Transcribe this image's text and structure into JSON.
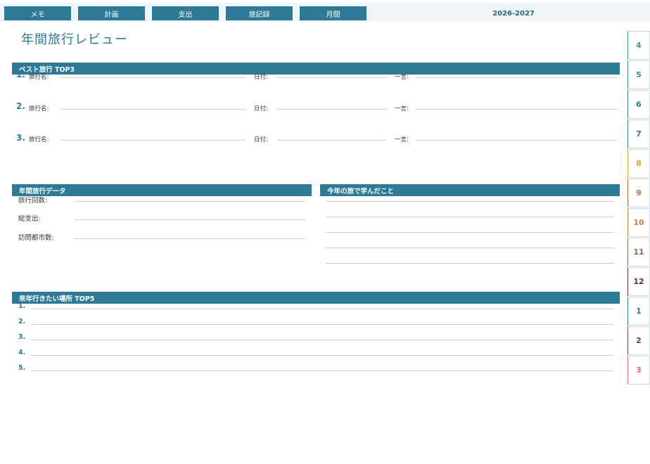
{
  "nav": {
    "buttons": [
      "メモ",
      "計画",
      "支出",
      "旅記録",
      "月間"
    ],
    "year": "2026-2027"
  },
  "page_title": "年間旅行レビュー",
  "best_trips": {
    "header": "ベスト旅行 TOP3",
    "items": [
      {
        "num": "1.",
        "name_label": "旅行名:",
        "date_label": "日付:",
        "comment_label": "一言:"
      },
      {
        "num": "2.",
        "name_label": "旅行名:",
        "date_label": "日付:",
        "comment_label": "一言:"
      },
      {
        "num": "3.",
        "name_label": "旅行名:",
        "date_label": "日付:",
        "comment_label": "一言:"
      }
    ]
  },
  "annual_data": {
    "header": "年間旅行データ",
    "fields": [
      "旅行回数:",
      "総支出:",
      "訪問都市数:"
    ]
  },
  "lessons": {
    "header": "今年の旅で学んだこと"
  },
  "next_year": {
    "header": "来年行きたい場所 TOP5",
    "items": [
      "1.",
      "2.",
      "3.",
      "4.",
      "5."
    ]
  },
  "month_tabs": [
    {
      "label": "4",
      "color": "#3aa67a"
    },
    {
      "label": "5",
      "color": "#2e9aa3"
    },
    {
      "label": "6",
      "color": "#2e7a96"
    },
    {
      "label": "7",
      "color": "#2e7a96"
    },
    {
      "label": "8",
      "color": "#e0a030"
    },
    {
      "label": "9",
      "color": "#d06a3a"
    },
    {
      "label": "10",
      "color": "#d07a3a"
    },
    {
      "label": "11",
      "color": "#8a6a5a"
    },
    {
      "label": "12",
      "color": "#6a2a3a"
    },
    {
      "label": "1",
      "color": "#2e7a96"
    },
    {
      "label": "2",
      "color": "#6a3a6a"
    },
    {
      "label": "3",
      "color": "#e06a7a"
    }
  ]
}
